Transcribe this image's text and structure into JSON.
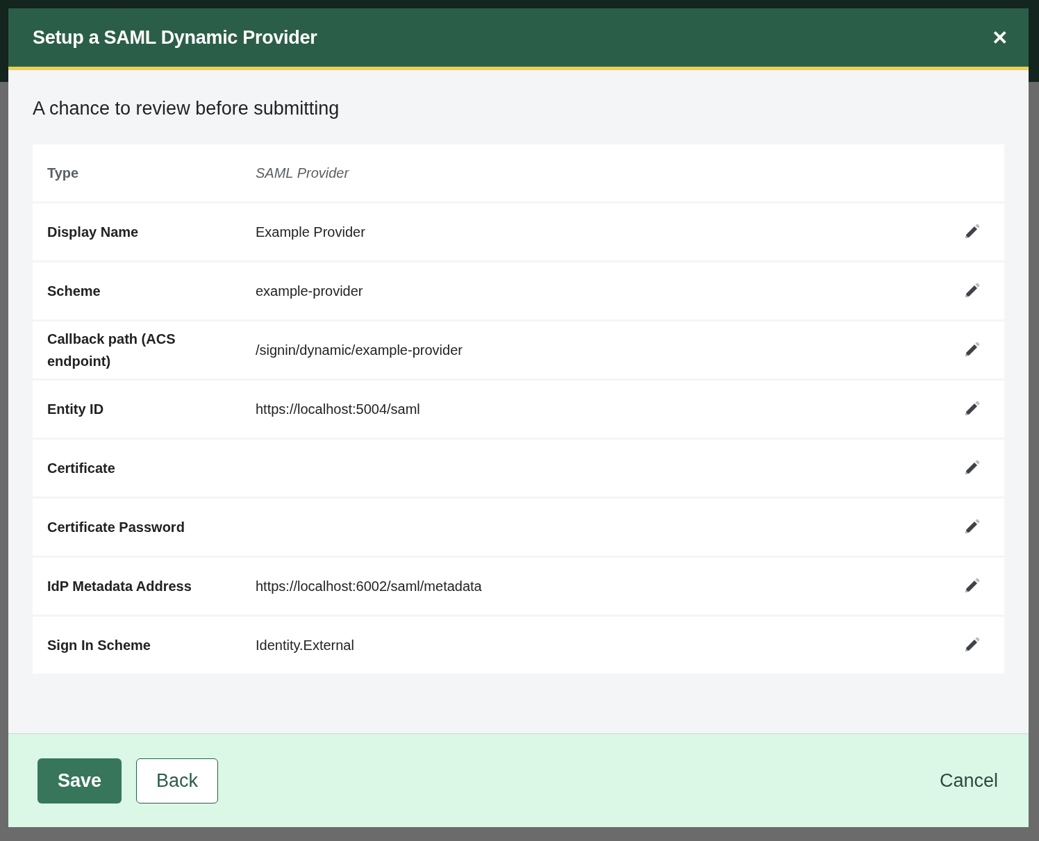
{
  "dialog": {
    "title": "Setup a SAML Dynamic Provider",
    "close": "✕",
    "subtitle": "A chance to review before submitting"
  },
  "rows": [
    {
      "label": "Type",
      "value": "SAML Provider",
      "editable": false
    },
    {
      "label": "Display Name",
      "value": "Example Provider",
      "editable": true
    },
    {
      "label": "Scheme",
      "value": "example-provider",
      "editable": true
    },
    {
      "label": "Callback path (ACS endpoint)",
      "value": "/signin/dynamic/example-provider",
      "editable": true
    },
    {
      "label": "Entity ID",
      "value": "https://localhost:5004/saml",
      "editable": true
    },
    {
      "label": "Certificate",
      "editable": true
    },
    {
      "label": "Certificate Password",
      "editable": true
    },
    {
      "label": "IdP Metadata Address",
      "value": "https://localhost:6002/saml/metadata",
      "editable": true
    },
    {
      "label": "Sign In Scheme",
      "value": "Identity.External",
      "editable": true
    }
  ],
  "buttons": [
    {
      "label": "Save",
      "kind": "primary"
    },
    {
      "label": "Back",
      "kind": "secondary"
    },
    {
      "label": "Cancel",
      "kind": "link"
    }
  ]
}
